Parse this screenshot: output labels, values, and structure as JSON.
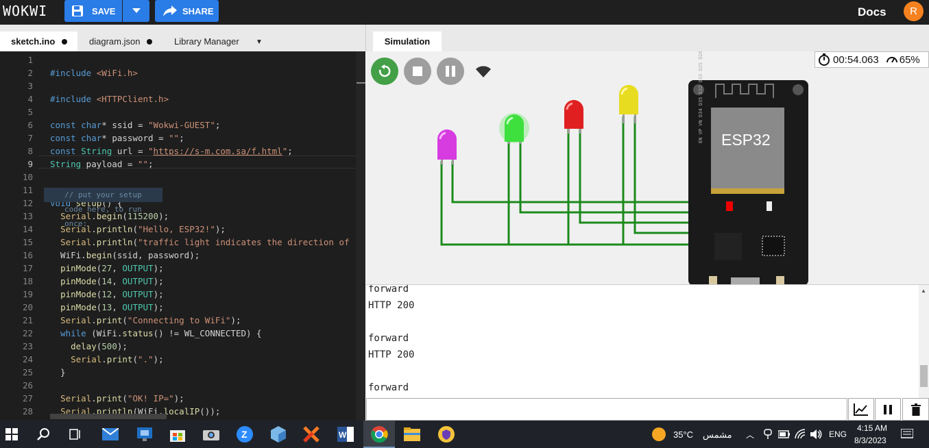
{
  "app": {
    "logo": "WOKWI",
    "save_label": "SAVE",
    "share_label": "SHARE",
    "docs_label": "Docs",
    "avatar_initial": "R"
  },
  "editor_tabs": [
    {
      "label": "sketch.ino"
    },
    {
      "label": "diagram.json"
    },
    {
      "label": "Library Manager"
    }
  ],
  "editor": {
    "line_numbers": [
      "1",
      "2",
      "3",
      "4",
      "5",
      "6",
      "7",
      "8",
      "9",
      "10",
      "11",
      "12",
      "13",
      "14",
      "15",
      "16",
      "17",
      "18",
      "19",
      "20",
      "21",
      "22",
      "23",
      "24",
      "25",
      "26",
      "27",
      "28"
    ],
    "hint": "// put your setup code here, to run once:"
  },
  "simulation": {
    "tab_label": "Simulation",
    "timer": "00:54.063",
    "speed": "65%",
    "chip_label": "ESP32"
  },
  "serial": {
    "lines": [
      "forward",
      "HTTP 200",
      "",
      "forward",
      "HTTP 200",
      "",
      "forward"
    ]
  },
  "taskbar": {
    "weather": "35°C",
    "weather_text": "مشمس",
    "lang": "ENG",
    "time": "4:15 AM",
    "date": "8/3/2023"
  },
  "colors": {
    "accent": "#2a7ce6",
    "avatar": "#f5821f",
    "wire": "#1b8a1b",
    "editor_bg": "#1e1e1e"
  }
}
